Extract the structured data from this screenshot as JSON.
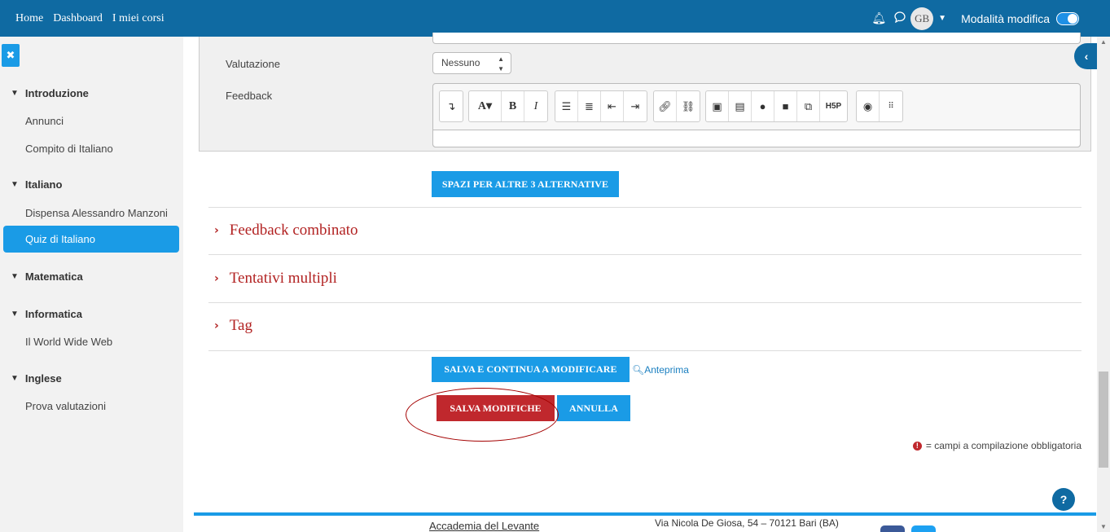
{
  "nav": {
    "links": [
      "Home",
      "Dashboard",
      "I miei corsi"
    ],
    "avatar_initials": "GB",
    "edit_mode_label": "Modalità modifica",
    "edit_mode_on": true
  },
  "sidebar": {
    "sections": [
      {
        "title": "Introduzione",
        "items": [
          "Annunci",
          "Compito di Italiano"
        ]
      },
      {
        "title": "Italiano",
        "items": [
          "Dispensa Alessandro Manzoni",
          "Quiz di Italiano"
        ]
      },
      {
        "title": "Matematica",
        "items": []
      },
      {
        "title": "Informatica",
        "items": [
          "Il World Wide Web"
        ]
      },
      {
        "title": "Inglese",
        "items": [
          "Prova valutazioni"
        ]
      }
    ],
    "active_item": "Quiz di Italiano"
  },
  "form": {
    "grade_label": "Valutazione",
    "grade_value": "Nessuno",
    "feedback_label": "Feedback",
    "add_choices_button": "SPAZI PER ALTRE 3 ALTERNATIVE"
  },
  "sections": [
    "Feedback combinato",
    "Tentativi multipli",
    "Tag"
  ],
  "actions": {
    "save_continue": "SALVA E CONTINUA A MODIFICARE",
    "preview": "Anteprima",
    "save": "SALVA MODIFICHE",
    "cancel": "ANNULLA"
  },
  "required_note": "= campi a compilazione obbligatoria",
  "footer": {
    "org_name": "Accademia del Levante",
    "address": "Via Nicola De Giosa, 54 – 70121 Bari (BA)"
  },
  "colors": {
    "navbar": "#0f6aa2",
    "accent": "#1a9be6",
    "danger": "#c0282d",
    "section_title": "#b22222"
  }
}
